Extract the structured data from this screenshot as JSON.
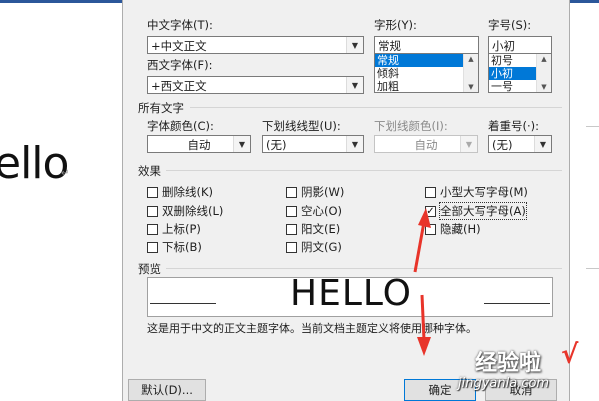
{
  "document": {
    "text": "ello",
    "para_mark": "↵"
  },
  "dialog": {
    "chinese_font": {
      "label": "中文字体(T):",
      "value": "+中文正文"
    },
    "western_font": {
      "label": "西文字体(F):",
      "value": "+西文正文"
    },
    "font_style": {
      "label": "字形(Y):",
      "value": "常规",
      "options": [
        "常规",
        "倾斜",
        "加粗"
      ],
      "selected": 0
    },
    "font_size": {
      "label": "字号(S):",
      "value": "小初",
      "options": [
        "初号",
        "小初",
        "一号"
      ],
      "selected": 1
    },
    "all_text": {
      "section": "所有文字",
      "font_color": {
        "label": "字体颜色(C):",
        "value": "自动"
      },
      "underline_style": {
        "label": "下划线线型(U):",
        "value": "(无)"
      },
      "underline_color": {
        "label": "下划线颜色(I):",
        "value": "自动"
      },
      "emphasis_mark": {
        "label": "着重号(·):",
        "value": "(无)"
      }
    },
    "effects": {
      "section": "效果",
      "strikethrough": {
        "label": "删除线(K)",
        "checked": false
      },
      "double_strikethrough": {
        "label": "双删除线(L)",
        "checked": false
      },
      "superscript": {
        "label": "上标(P)",
        "checked": false
      },
      "subscript": {
        "label": "下标(B)",
        "checked": false
      },
      "shadow": {
        "label": "阴影(W)",
        "checked": false
      },
      "outline": {
        "label": "空心(O)",
        "checked": false
      },
      "emboss": {
        "label": "阳文(E)",
        "checked": false
      },
      "engrave": {
        "label": "阴文(G)",
        "checked": false
      },
      "small_caps": {
        "label": "小型大写字母(M)",
        "checked": false
      },
      "all_caps": {
        "label": "全部大写字母(A)",
        "checked": true,
        "mark": "✓"
      },
      "hidden": {
        "label": "隐藏(H)",
        "checked": false
      }
    },
    "preview": {
      "section": "预览",
      "sample": "HELLO",
      "note": "这是用于中文的正文主题字体。当前文档主题定义将使用哪种字体。"
    },
    "buttons": {
      "default": "默认(D)...",
      "ok": "确定",
      "cancel": "取消"
    }
  },
  "watermark": {
    "brand": "经验啦",
    "check": "√",
    "url": "jingyanla.com"
  },
  "colors": {
    "annotation_arrow": "#e8342a",
    "selection": "#0078d7",
    "dialog_bg": "#f0f0f0"
  }
}
